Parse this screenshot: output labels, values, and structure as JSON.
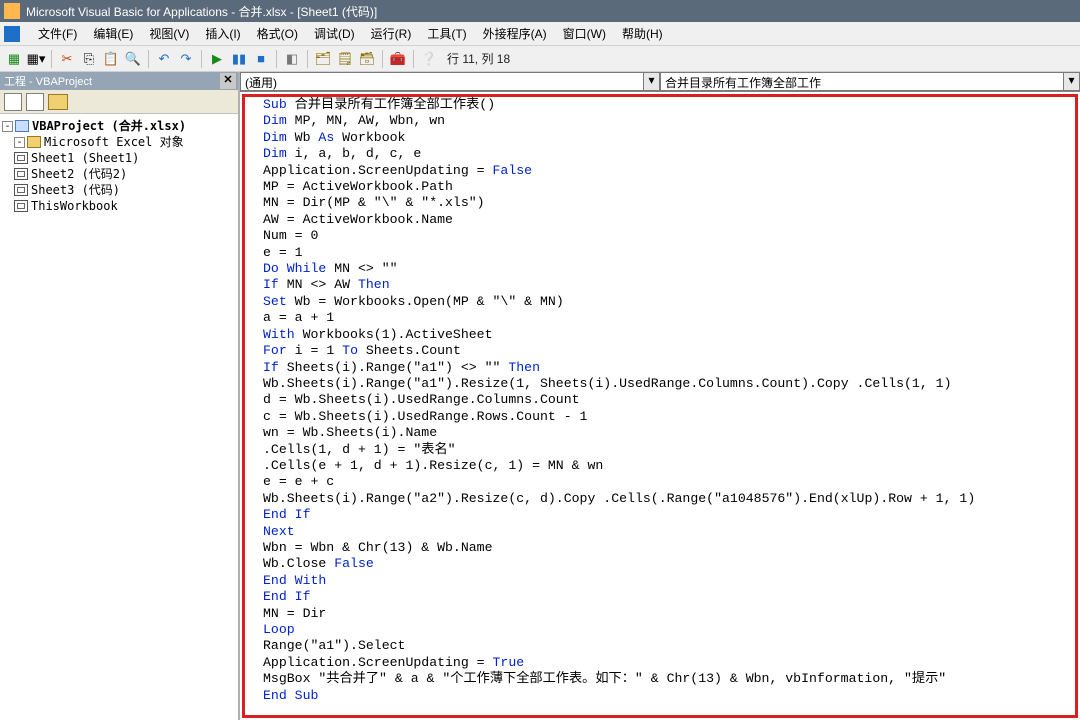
{
  "window": {
    "title": "Microsoft Visual Basic for Applications - 合并.xlsx - [Sheet1 (代码)]"
  },
  "menu": {
    "file": "文件(F)",
    "edit": "编辑(E)",
    "view": "视图(V)",
    "insert": "插入(I)",
    "format": "格式(O)",
    "debug": "调试(D)",
    "run": "运行(R)",
    "tools": "工具(T)",
    "addins": "外接程序(A)",
    "window": "窗口(W)",
    "help": "帮助(H)"
  },
  "toolbar": {
    "cursor_position": "行 11, 列 18"
  },
  "project_pane": {
    "title": "工程 - VBAProject",
    "root": "VBAProject (合并.xlsx)",
    "folder": "Microsoft Excel 对象",
    "sheets": {
      "s1": "Sheet1 (Sheet1)",
      "s2": "Sheet2 (代码2)",
      "s3": "Sheet3 (代码)",
      "wb": "ThisWorkbook"
    }
  },
  "code_pane": {
    "dd_general": "(通用)",
    "dd_proc": "合并目录所有工作簿全部工作"
  },
  "code": {
    "l01a": "Sub",
    "l01b": " 合并目录所有工作簿全部工作表()",
    "l02a": "Dim",
    "l02b": " MP, MN, AW, Wbn, wn",
    "l03a": "Dim",
    "l03b": " Wb ",
    "l03c": "As",
    "l03d": " Workbook",
    "l04a": "Dim",
    "l04b": " i, a, b, d, c, e",
    "l05a": "Application.ScreenUpdating = ",
    "l05b": "False",
    "l06": "MP = ActiveWorkbook.Path",
    "l07": "MN = Dir(MP & \"\\\" & \"*.xls\")",
    "l08": "AW = ActiveWorkbook.Name",
    "l09": "Num = 0",
    "l10": "e = 1",
    "l11a": "Do While",
    "l11b": " MN <> \"\"",
    "l12a": "If",
    "l12b": " MN <> AW ",
    "l12c": "Then",
    "l13a": "Set",
    "l13b": " Wb = Workbooks.Open(MP & \"\\\" & MN)",
    "l14": "a = a + 1",
    "l15a": "With",
    "l15b": " Workbooks(1).ActiveSheet",
    "l16a": "For",
    "l16b": " i = 1 ",
    "l16c": "To",
    "l16d": " Sheets.Count",
    "l17a": "If",
    "l17b": " Sheets(i).Range(\"a1\") <> \"\" ",
    "l17c": "Then",
    "l18": "Wb.Sheets(i).Range(\"a1\").Resize(1, Sheets(i).UsedRange.Columns.Count).Copy .Cells(1, 1)",
    "l19": "d = Wb.Sheets(i).UsedRange.Columns.Count",
    "l20": "c = Wb.Sheets(i).UsedRange.Rows.Count - 1",
    "l21": "wn = Wb.Sheets(i).Name",
    "l22": ".Cells(1, d + 1) = \"表名\"",
    "l23": ".Cells(e + 1, d + 1).Resize(c, 1) = MN & wn",
    "l24": "e = e + c",
    "l25": "Wb.Sheets(i).Range(\"a2\").Resize(c, d).Copy .Cells(.Range(\"a1048576\").End(xlUp).Row + 1, 1)",
    "l26": "End If",
    "l27": "Next",
    "l28": "Wbn = Wbn & Chr(13) & Wb.Name",
    "l29a": "Wb.Close ",
    "l29b": "False",
    "l30": "End With",
    "l31": "End If",
    "l32": "MN = Dir",
    "l33": "Loop",
    "l34": "Range(\"a1\").Select",
    "l35a": "Application.ScreenUpdating = ",
    "l35b": "True",
    "l36": "MsgBox \"共合并了\" & a & \"个工作薄下全部工作表。如下：\" & Chr(13) & Wbn, vbInformation, \"提示\"",
    "l37": "End Sub"
  }
}
